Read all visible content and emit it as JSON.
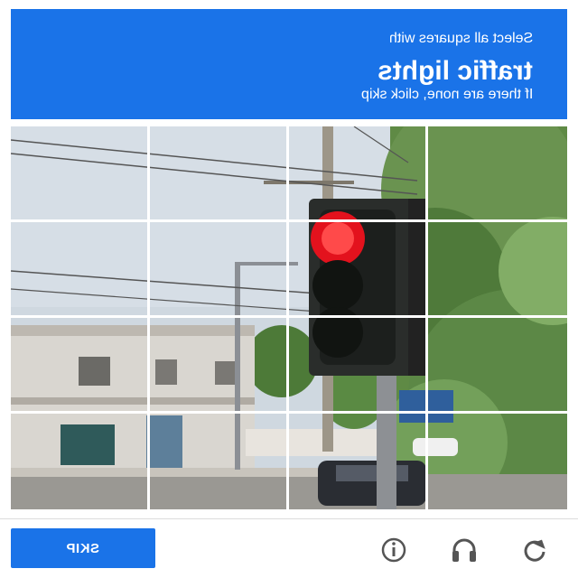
{
  "header": {
    "instruction": "Select all squares with",
    "target": "traffic lights",
    "hint": "If there are none, click skip"
  },
  "grid": {
    "rows": 4,
    "cols": 4
  },
  "footer": {
    "skip_label": "SKIP",
    "icons": [
      "reload-icon",
      "audio-icon",
      "info-icon"
    ]
  },
  "colors": {
    "accent": "#1a73e8",
    "light_red": "#e3121d"
  }
}
